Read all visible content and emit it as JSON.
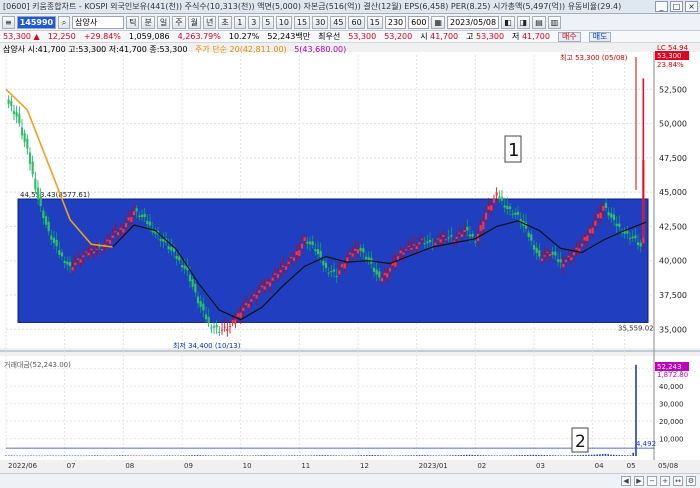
{
  "window": {
    "title": "[0600] 키움종합차트 - KOSPI 외국인보유(441(천)) 주식수(10,313(천)) 액면(5,000) 자본금(516(억)) 결산(12월) EPS(6,458) PER(8.25) 시가총액(5,497(억)) 유동비율(29.4)",
    "buttons": [
      "_",
      "□",
      "×"
    ]
  },
  "toolbar": {
    "code": "145990",
    "stock_name": "삼양사",
    "periods": [
      "틱",
      "분",
      "일",
      "주",
      "월",
      "년",
      "초"
    ],
    "numbers": [
      "1",
      "3",
      "5",
      "10",
      "15",
      "30",
      "45",
      "60",
      "15"
    ],
    "count": "230",
    "count_total": "600",
    "date": "2023/05/08"
  },
  "quote": {
    "price": "53,300",
    "change": "12,250",
    "change_pct": "+29.84%",
    "volume": "1,059,086",
    "vol_ratio": "4,263.79%",
    "turnover": "10.27%",
    "amount": "52,243백만",
    "best_bid_label": "최우선",
    "bid": "53,300",
    "ask": "53,200",
    "open_label": "시",
    "open": "41,700",
    "high_label": "고",
    "high": "53,300",
    "low_label": "저",
    "low": "41,700",
    "buy_label": "매수",
    "sell_label": "매도"
  },
  "info": {
    "ohlc": "삼양사 시:41,700 고:53,300 저:41,700 종:53,300",
    "ma20": "주가 단순 20(42,811.00)",
    "ma5": "5(43,680.00)"
  },
  "chart_data": [
    {
      "type": "candlestick",
      "title": "",
      "x_tick_labels": [
        "2022/06",
        "07",
        "08",
        "09",
        "10",
        "11",
        "12",
        "2023/01",
        "02",
        "03",
        "04",
        "05",
        "05/08"
      ],
      "y_tick_labels": [
        "52,500",
        "50,000",
        "47,500",
        "45,000",
        "42,500",
        "40,000",
        "37,500",
        "35,000"
      ],
      "ylim": [
        34000,
        55000
      ],
      "price_points": [
        {
          "t": 0,
          "v": 51800
        },
        {
          "t": 4,
          "v": 50500
        },
        {
          "t": 8,
          "v": 48000
        },
        {
          "t": 12,
          "v": 44500
        },
        {
          "t": 16,
          "v": 42000
        },
        {
          "t": 20,
          "v": 40500
        },
        {
          "t": 24,
          "v": 39500
        },
        {
          "t": 28,
          "v": 40200
        },
        {
          "t": 32,
          "v": 40800
        },
        {
          "t": 36,
          "v": 41000
        },
        {
          "t": 40,
          "v": 41800
        },
        {
          "t": 44,
          "v": 42500
        },
        {
          "t": 48,
          "v": 43600
        },
        {
          "t": 52,
          "v": 43000
        },
        {
          "t": 56,
          "v": 42000
        },
        {
          "t": 60,
          "v": 41200
        },
        {
          "t": 64,
          "v": 40200
        },
        {
          "t": 68,
          "v": 39200
        },
        {
          "t": 72,
          "v": 37000
        },
        {
          "t": 76,
          "v": 35400
        },
        {
          "t": 80,
          "v": 34900
        },
        {
          "t": 84,
          "v": 35200
        },
        {
          "t": 88,
          "v": 36400
        },
        {
          "t": 92,
          "v": 37200
        },
        {
          "t": 96,
          "v": 38000
        },
        {
          "t": 100,
          "v": 38800
        },
        {
          "t": 104,
          "v": 39500
        },
        {
          "t": 108,
          "v": 40300
        },
        {
          "t": 112,
          "v": 41600
        },
        {
          "t": 116,
          "v": 40800
        },
        {
          "t": 120,
          "v": 39400
        },
        {
          "t": 124,
          "v": 39000
        },
        {
          "t": 128,
          "v": 40200
        },
        {
          "t": 132,
          "v": 41000
        },
        {
          "t": 136,
          "v": 40000
        },
        {
          "t": 140,
          "v": 38600
        },
        {
          "t": 144,
          "v": 39500
        },
        {
          "t": 148,
          "v": 40600
        },
        {
          "t": 152,
          "v": 41000
        },
        {
          "t": 156,
          "v": 41500
        },
        {
          "t": 160,
          "v": 41100
        },
        {
          "t": 164,
          "v": 41800
        },
        {
          "t": 168,
          "v": 41600
        },
        {
          "t": 172,
          "v": 42200
        },
        {
          "t": 176,
          "v": 41500
        },
        {
          "t": 180,
          "v": 43500
        },
        {
          "t": 184,
          "v": 44800
        },
        {
          "t": 188,
          "v": 43800
        },
        {
          "t": 192,
          "v": 43200
        },
        {
          "t": 196,
          "v": 41800
        },
        {
          "t": 200,
          "v": 40200
        },
        {
          "t": 204,
          "v": 40600
        },
        {
          "t": 208,
          "v": 39800
        },
        {
          "t": 212,
          "v": 40400
        },
        {
          "t": 216,
          "v": 41200
        },
        {
          "t": 220,
          "v": 42600
        },
        {
          "t": 224,
          "v": 44000
        },
        {
          "t": 228,
          "v": 42800
        },
        {
          "t": 232,
          "v": 42000
        },
        {
          "t": 236,
          "v": 41500
        },
        {
          "t": 238,
          "v": 41000
        },
        {
          "t": 240,
          "v": 53300
        }
      ],
      "ma20": [
        {
          "t": 0,
          "v": 52500
        },
        {
          "t": 8,
          "v": 51000
        },
        {
          "t": 16,
          "v": 47000
        },
        {
          "t": 24,
          "v": 43000
        },
        {
          "t": 32,
          "v": 41200
        },
        {
          "t": 40,
          "v": 41000
        },
        {
          "t": 48,
          "v": 42600
        },
        {
          "t": 56,
          "v": 42200
        },
        {
          "t": 64,
          "v": 40800
        },
        {
          "t": 72,
          "v": 38400
        },
        {
          "t": 80,
          "v": 36400
        },
        {
          "t": 88,
          "v": 35700
        },
        {
          "t": 96,
          "v": 36600
        },
        {
          "t": 104,
          "v": 38200
        },
        {
          "t": 112,
          "v": 39600
        },
        {
          "t": 120,
          "v": 40300
        },
        {
          "t": 128,
          "v": 39900
        },
        {
          "t": 136,
          "v": 40000
        },
        {
          "t": 144,
          "v": 39800
        },
        {
          "t": 152,
          "v": 40400
        },
        {
          "t": 160,
          "v": 41000
        },
        {
          "t": 168,
          "v": 41300
        },
        {
          "t": 176,
          "v": 41600
        },
        {
          "t": 184,
          "v": 42500
        },
        {
          "t": 192,
          "v": 42900
        },
        {
          "t": 200,
          "v": 42200
        },
        {
          "t": 208,
          "v": 40900
        },
        {
          "t": 216,
          "v": 40600
        },
        {
          "t": 224,
          "v": 41500
        },
        {
          "t": 232,
          "v": 42200
        },
        {
          "t": 240,
          "v": 42811
        }
      ],
      "box_range": [
        35500,
        44500
      ],
      "box_high_label": "44,553.43(8577.61)",
      "box_low_label": "35,559.02",
      "high_marker": "최고 53,300 (05/08)",
      "low_marker": "최저 34,400 (10/13)",
      "annotation_1": "1",
      "current_label": "LC 54.94",
      "current_price_tag": "53,300",
      "current_pct_tag": "23.84%"
    },
    {
      "type": "bar",
      "title": "거래대금(52,243.00)",
      "y_tick_labels": [
        "50,000",
        "40,000",
        "30,000",
        "20,000",
        "10,000"
      ],
      "ylim": [
        0,
        55000
      ],
      "last_value_label": "52,243",
      "prev_value_label": "1,872.80",
      "avg_label": "4,492",
      "annotation_2": "2",
      "values_note": "daily trading amount",
      "values": [
        300,
        280,
        350,
        260,
        240,
        220,
        200,
        260,
        240,
        300,
        260,
        220,
        240,
        210,
        260,
        300,
        280,
        250,
        230,
        260,
        240,
        320,
        280,
        260,
        240,
        300,
        260,
        240,
        220,
        260,
        300,
        340,
        400,
        380,
        320,
        300,
        260,
        240,
        280,
        300,
        320,
        360,
        420,
        380,
        340,
        300,
        280,
        260,
        240,
        220,
        260,
        300,
        280,
        260,
        240,
        260,
        280,
        300,
        320,
        340,
        300,
        280,
        260,
        300,
        340,
        380,
        400,
        440,
        480,
        520,
        460,
        420,
        380,
        340,
        300,
        280,
        320,
        360,
        400,
        380,
        340,
        300,
        280,
        320,
        360,
        340,
        300,
        280,
        260,
        300,
        340,
        380,
        420,
        460,
        440,
        400,
        360,
        320,
        300,
        280,
        260,
        300,
        340,
        380,
        400,
        360,
        320,
        300,
        280,
        300,
        340,
        380,
        420,
        460,
        500,
        480,
        440,
        400,
        360,
        320,
        300,
        280,
        260,
        300,
        320,
        340,
        360,
        400,
        440,
        480,
        520,
        560,
        600,
        540,
        480,
        420,
        380,
        340,
        300,
        280,
        260,
        300,
        340,
        360,
        380,
        400,
        420,
        440,
        460,
        480,
        500,
        460,
        420,
        380,
        340,
        300,
        280,
        300,
        320,
        340,
        380,
        420,
        460,
        500,
        560,
        620,
        680,
        720,
        680,
        620,
        560,
        500,
        440,
        400,
        360,
        340,
        320,
        300,
        320,
        340,
        360,
        380,
        400,
        420,
        460,
        500,
        540,
        580,
        620,
        660,
        700,
        660,
        620,
        580,
        540,
        500,
        460,
        420,
        380,
        340,
        320,
        300,
        340,
        380,
        420,
        460,
        500,
        540,
        580,
        620,
        660,
        720,
        800,
        900,
        1000,
        1100,
        1200,
        1000,
        800,
        700,
        600,
        520,
        480,
        440,
        420,
        400,
        1872,
        52243
      ]
    }
  ]
}
